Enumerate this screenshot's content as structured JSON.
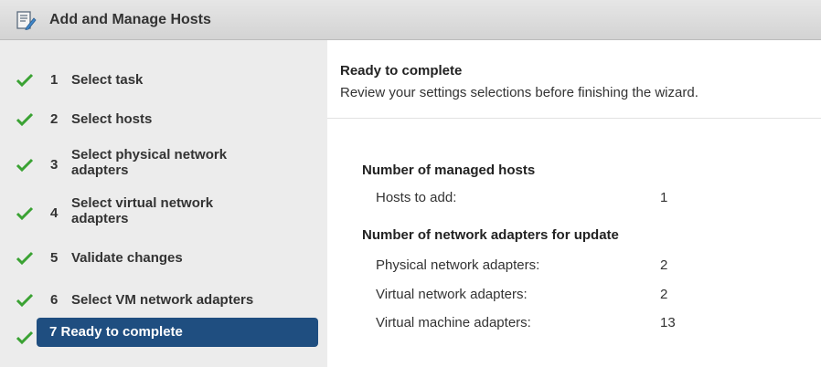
{
  "window": {
    "title": "Add and Manage Hosts",
    "icon": "wizard-icon"
  },
  "steps": [
    {
      "num": "1",
      "label": "Select task",
      "done": true
    },
    {
      "num": "2",
      "label": "Select hosts",
      "done": true
    },
    {
      "num": "3",
      "label_line1": "Select physical network",
      "label_line2": "adapters",
      "done": true
    },
    {
      "num": "4",
      "label_line1": "Select virtual network",
      "label_line2": "adapters",
      "done": true
    },
    {
      "num": "5",
      "label": "Validate changes",
      "done": true
    },
    {
      "num": "6",
      "label": "Select VM network adapters",
      "done": true
    },
    {
      "num": "7",
      "label": "7 Ready to complete",
      "done": true,
      "active": true
    }
  ],
  "main": {
    "heading": "Ready to complete",
    "subheading": "Review your settings selections before finishing the wizard.",
    "sections": [
      {
        "title": "Number of managed hosts",
        "rows": [
          {
            "label": "Hosts to add:",
            "value": "1"
          }
        ]
      },
      {
        "title": "Number of network adapters for update",
        "rows": [
          {
            "label": "Physical network adapters:",
            "value": "2"
          },
          {
            "label": "Virtual network adapters:",
            "value": "2"
          },
          {
            "label": "Virtual machine adapters:",
            "value": "13"
          }
        ]
      }
    ]
  },
  "colors": {
    "check": "#3aa233",
    "active": "#1f4e80",
    "sidebar": "#ececec"
  }
}
